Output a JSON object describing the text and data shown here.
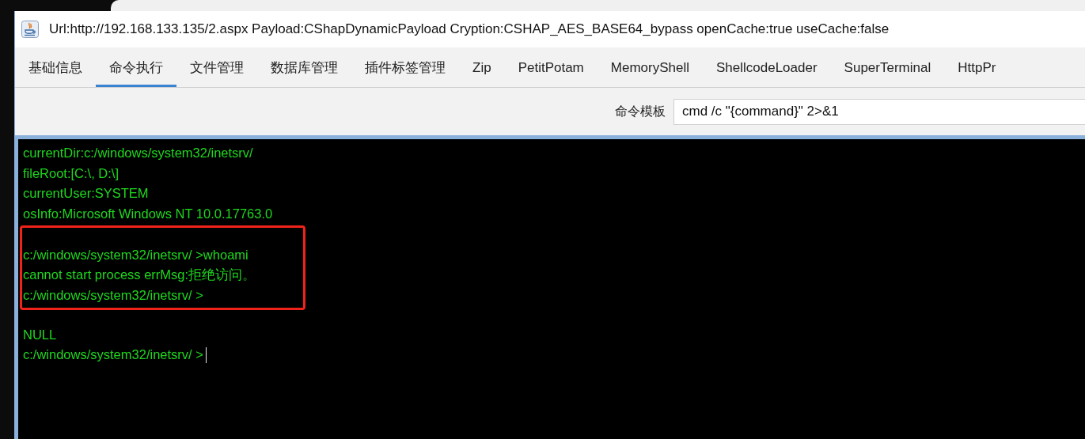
{
  "window": {
    "title": "Url:http://192.168.133.135/2.aspx Payload:CShapDynamicPayload Cryption:CSHAP_AES_BASE64_bypass openCache:true useCache:false"
  },
  "tabs": [
    {
      "label": "基础信息",
      "selected": false
    },
    {
      "label": "命令执行",
      "selected": true
    },
    {
      "label": "文件管理",
      "selected": false
    },
    {
      "label": "数据库管理",
      "selected": false
    },
    {
      "label": "插件标签管理",
      "selected": false
    },
    {
      "label": "Zip",
      "selected": false
    },
    {
      "label": "PetitPotam",
      "selected": false
    },
    {
      "label": "MemoryShell",
      "selected": false
    },
    {
      "label": "ShellcodeLoader",
      "selected": false
    },
    {
      "label": "SuperTerminal",
      "selected": false
    },
    {
      "label": "HttpPr",
      "selected": false
    }
  ],
  "command_template": {
    "label": "命令模板",
    "value": "cmd /c \"{command}\" 2>&1"
  },
  "terminal": {
    "blocks": [
      {
        "highlighted": false,
        "lines": [
          "currentDir:c:/windows/system32/inetsrv/",
          "fileRoot:[C:\\, D:\\]",
          "currentUser:SYSTEM",
          "osInfo:Microsoft Windows NT 10.0.17763.0"
        ]
      },
      {
        "highlighted": true,
        "lines": [
          "c:/windows/system32/inetsrv/ >whoami",
          "cannot start process errMsg:拒绝访问。",
          "c:/windows/system32/inetsrv/ >"
        ]
      },
      {
        "highlighted": false,
        "lines": [
          "NULL",
          "c:/windows/system32/inetsrv/ >"
        ]
      }
    ],
    "cursor": true
  }
}
